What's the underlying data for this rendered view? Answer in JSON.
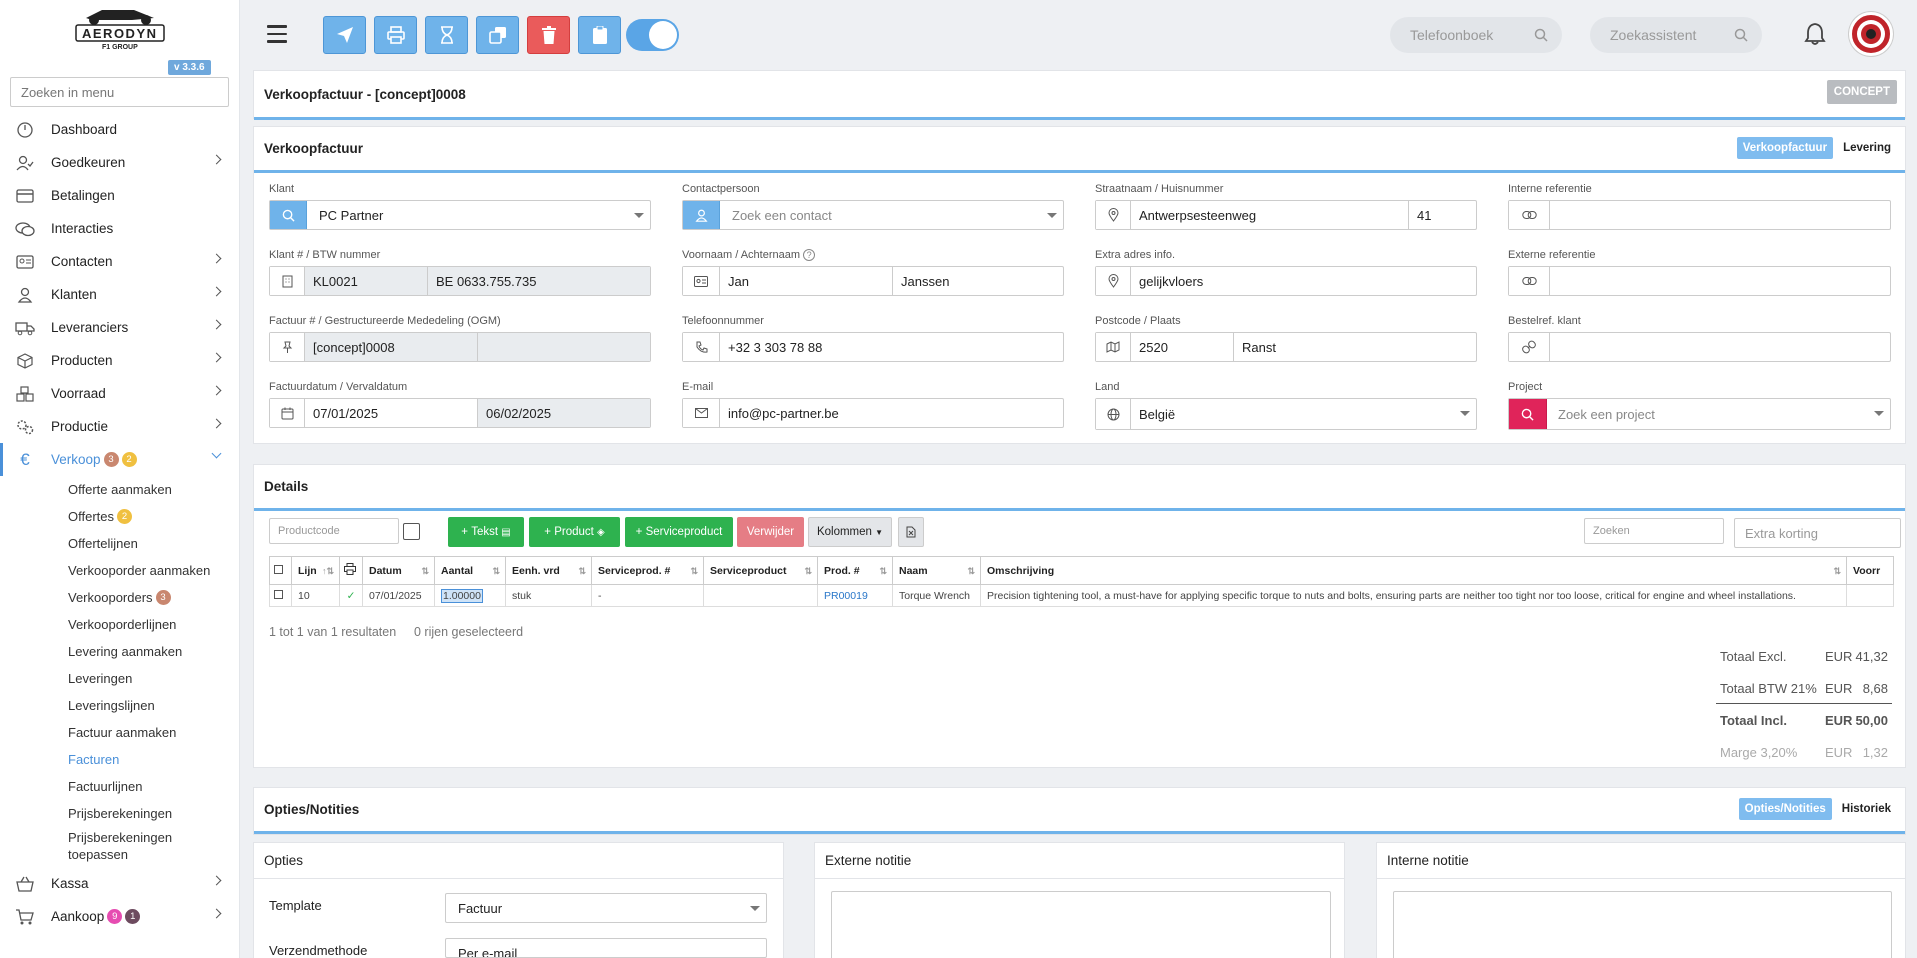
{
  "app": {
    "brand": "AERODYN",
    "brand_sub": "F1 GROUP",
    "version": "v 3.3.6"
  },
  "sidebar": {
    "search_placeholder": "Zoeken in menu",
    "items": [
      {
        "label": "Dashboard",
        "icon": "dashboard-icon"
      },
      {
        "label": "Goedkeuren",
        "icon": "user-check-icon"
      },
      {
        "label": "Betalingen",
        "icon": "credit-card-icon"
      },
      {
        "label": "Interacties",
        "icon": "chat-icon"
      },
      {
        "label": "Contacten",
        "icon": "address-card-icon"
      },
      {
        "label": "Klanten",
        "icon": "user-icon"
      },
      {
        "label": "Leveranciers",
        "icon": "truck-icon"
      },
      {
        "label": "Producten",
        "icon": "box-icon"
      },
      {
        "label": "Voorraad",
        "icon": "boxes-icon"
      },
      {
        "label": "Productie",
        "icon": "gears-icon"
      },
      {
        "label": "Verkoop",
        "icon": "euro-icon",
        "badge1": "3",
        "badge2": "2"
      }
    ],
    "sub_items": [
      {
        "label": "Offerte aanmaken"
      },
      {
        "label": "Offertes",
        "badge": "2"
      },
      {
        "label": "Offertelijnen"
      },
      {
        "label": "Verkooporder aanmaken"
      },
      {
        "label": "Verkooporders",
        "badge": "3"
      },
      {
        "label": "Verkooporderlijnen"
      },
      {
        "label": "Levering aanmaken"
      },
      {
        "label": "Leveringen"
      },
      {
        "label": "Leveringslijnen"
      },
      {
        "label": "Factuur aanmaken"
      },
      {
        "label": "Facturen"
      },
      {
        "label": "Factuurlijnen"
      },
      {
        "label": "Prijsberekeningen"
      },
      {
        "label": "Prijsberekeningen toepassen"
      }
    ],
    "after": [
      {
        "label": "Kassa"
      },
      {
        "label": "Aankoop",
        "badge1": "9",
        "badge2": "1"
      }
    ]
  },
  "topbar": {
    "phonebook_placeholder": "Telefoonboek",
    "assistant_placeholder": "Zoekassistent"
  },
  "header": {
    "title": "Verkoopfactuur - [concept]0008",
    "status": "CONCEPT"
  },
  "invoice": {
    "title": "Verkoopfactuur",
    "tabs": [
      "Verkoopfactuur",
      "Levering"
    ],
    "klant_label": "Klant",
    "klant": "PC Partner",
    "contact_label": "Contactpersoon",
    "contact_placeholder": "Zoek een contact",
    "street_label": "Straatnaam / Huisnummer",
    "street": "Antwerpsesteenweg",
    "number": "41",
    "int_ref_label": "Interne referentie",
    "klantnr_label": "Klant # / BTW nummer",
    "klantnr": "KL0021",
    "btw": "BE 0633.755.735",
    "name_label": "Voornaam / Achternaam",
    "first": "Jan",
    "last": "Janssen",
    "extra_label": "Extra adres info.",
    "extra": "gelijkvloers",
    "ext_ref_label": "Externe referentie",
    "factuur_label": "Factuur # / Gestructureerde Mededeling (OGM)",
    "factuur": "[concept]0008",
    "tel_label": "Telefoonnummer",
    "tel": "+32 3 303 78 88",
    "postcode_label": "Postcode / Plaats",
    "postcode": "2520",
    "plaats": "Ranst",
    "bestel_label": "Bestelref. klant",
    "date_label": "Factuurdatum / Vervaldatum",
    "date": "07/01/2025",
    "due": "06/02/2025",
    "email_label": "E-mail",
    "email": "info@pc-partner.be",
    "land_label": "Land",
    "land": "België",
    "project_label": "Project",
    "project_placeholder": "Zoek een project"
  },
  "details": {
    "title": "Details",
    "productcode_placeholder": "Productcode",
    "btn_tekst": "Tekst",
    "btn_product": "Product",
    "btn_service": "Serviceproduct",
    "btn_delete": "Verwijder",
    "btn_columns": "Kolommen",
    "search_placeholder": "Zoeken",
    "discount_placeholder": "Extra korting",
    "columns": [
      "Lijn",
      "Datum",
      "Aantal",
      "Eenh. vrd",
      "Serviceprod. #",
      "Serviceproduct",
      "Prod. #",
      "Naam",
      "Omschrijving",
      "Voorr"
    ],
    "rows": [
      {
        "lijn": "10",
        "datum": "07/01/2025",
        "aantal": "1.00000",
        "eenheid": "stuk",
        "serviceprod": "-",
        "service": "",
        "prod": "PR00019",
        "naam": "Torque Wrench",
        "omschrijving": "Precision tightening tool, a must-have for applying specific torque to nuts and bolts, ensuring parts are neither too tight nor too loose, critical for engine and wheel installations."
      }
    ],
    "result_info": "1 tot 1 van 1 resultaten",
    "selected_info": "0 rijen geselecteerd",
    "totals": {
      "excl_label": "Totaal Excl.",
      "excl": "41,32",
      "btw_label": "Totaal BTW 21%",
      "btw": "8,68",
      "incl_label": "Totaal Incl.",
      "incl": "50,00",
      "marge_label": "Marge 3,20%",
      "marge": "1,32",
      "currency": "EUR"
    }
  },
  "options": {
    "title": "Opties/Notities",
    "tabs": [
      "Opties/Notities",
      "Historiek"
    ],
    "opties_title": "Opties",
    "template_label": "Template",
    "template": "Factuur",
    "verzend_label": "Verzendmethode",
    "verzend": "Per e-mail",
    "ext_note_title": "Externe notitie",
    "int_note_title": "Interne notitie"
  }
}
